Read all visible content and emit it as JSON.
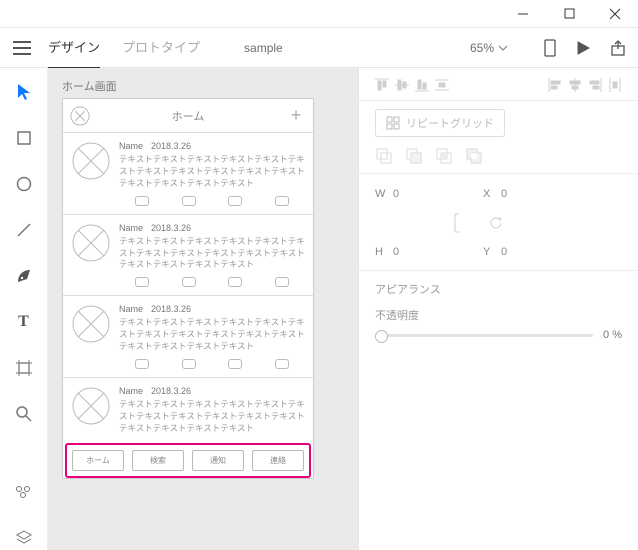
{
  "tabs": {
    "design": "デザイン",
    "prototype": "プロトタイプ"
  },
  "filename": "sample",
  "zoom": "65%",
  "artboard": {
    "label": "ホーム画面",
    "title": "ホーム",
    "card": {
      "name": "Name",
      "date": "2018.3.26",
      "text": "テキストテキストテキストテキストテキストテキストテキストテキストテキストテキストテキストテキストテキストテキストテキスト"
    },
    "tabbar": [
      "ホーム",
      "検索",
      "通知",
      "連絡"
    ]
  },
  "panel": {
    "repeat_grid": "リピートグリッド",
    "w_label": "W",
    "w_val": "0",
    "h_label": "H",
    "h_val": "0",
    "x_label": "X",
    "x_val": "0",
    "y_label": "Y",
    "y_val": "0",
    "appearance": "アピアランス",
    "opacity_label": "不透明度",
    "opacity_val": "0 %"
  }
}
